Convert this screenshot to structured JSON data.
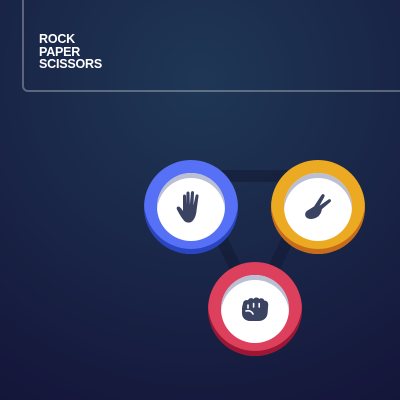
{
  "header": {
    "logo_lines": [
      "ROCK",
      "PAPER",
      "SCISSORS"
    ]
  },
  "tokens": [
    {
      "name": "paper",
      "icon": "paper-hand-icon",
      "color": "#5671f5",
      "shadow": "#2a45c2"
    },
    {
      "name": "scissors",
      "icon": "scissors-hand-icon",
      "color": "#eca922",
      "shadow": "#c76c1b"
    },
    {
      "name": "rock",
      "icon": "rock-fist-icon",
      "color": "#dd405d",
      "shadow": "#9d1634"
    }
  ],
  "colors": {
    "icon": "#3b4363",
    "triangle": "#131a34"
  }
}
